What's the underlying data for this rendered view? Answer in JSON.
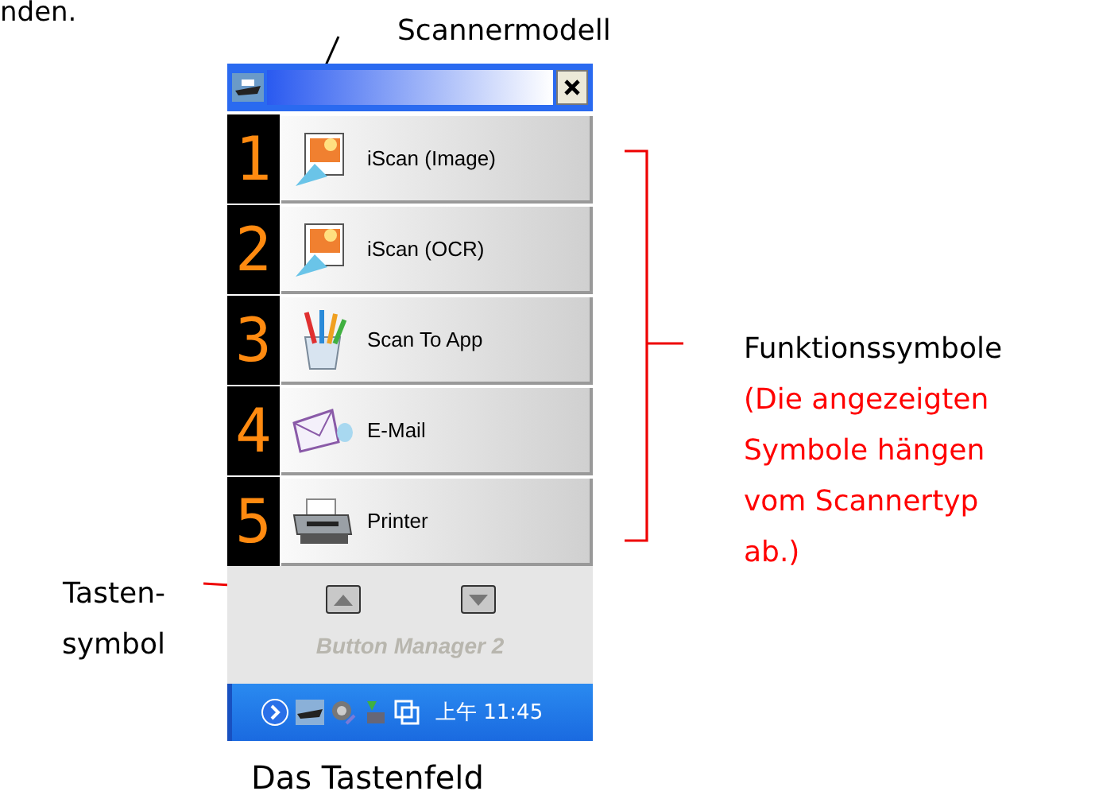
{
  "document_text": "nden.",
  "model_label": "Scannermodell",
  "functions_label": "Funktionssymbole",
  "functions_note_lines": [
    "(Die angezeigten",
    "Symbole hängen",
    "vom Scannertyp",
    "ab.)"
  ],
  "button_label_lines": [
    "Tasten-",
    "symbol"
  ],
  "panel": {
    "functions": [
      {
        "digit": "1",
        "label": "iScan (Image)",
        "kind": "image"
      },
      {
        "digit": "2",
        "label": "iScan (OCR)",
        "kind": "image"
      },
      {
        "digit": "3",
        "label": "Scan To App",
        "kind": "app"
      },
      {
        "digit": "4",
        "label": "E-Mail",
        "kind": "mail"
      },
      {
        "digit": "5",
        "label": "Printer",
        "kind": "printer"
      }
    ],
    "brand": "Button Manager 2"
  },
  "taskbar": {
    "clock": "上午 11:45"
  },
  "caption": "Das Tastenfeld"
}
